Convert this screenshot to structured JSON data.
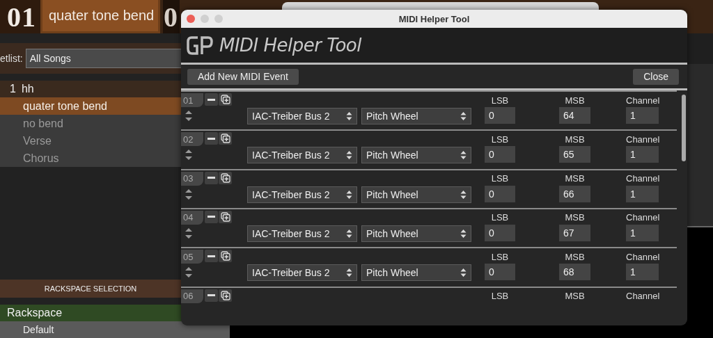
{
  "background_app": {
    "header": {
      "song_number": "01",
      "song_title": "quater tone bend",
      "next_number": "0"
    },
    "setlist": {
      "label": "etlist:",
      "value": "All Songs"
    },
    "songs": [
      {
        "number": "1",
        "name": "hh",
        "parts": [
          {
            "label": "quater tone bend",
            "selected": true
          },
          {
            "label": "no bend",
            "selected": false
          },
          {
            "label": "Verse",
            "selected": false
          },
          {
            "label": "Chorus",
            "selected": false
          }
        ]
      }
    ],
    "rackspace_header": "RACKSPACE SELECTION",
    "rackspaces": [
      {
        "label": "Rackspace",
        "kind": "group"
      },
      {
        "label": "Default",
        "kind": "item"
      }
    ]
  },
  "dialog": {
    "title": "MIDI Helper Tool",
    "banner_title": "MIDI Helper Tool",
    "add_button": "Add New MIDI Event",
    "close_button": "Close",
    "events": [
      {
        "number": "01",
        "device": "IAC-Treiber Bus 2",
        "message": "Pitch Wheel",
        "labels": [
          "LSB",
          "MSB",
          "Channel"
        ],
        "values": [
          "0",
          "64",
          "1"
        ]
      },
      {
        "number": "02",
        "device": "IAC-Treiber Bus 2",
        "message": "Pitch Wheel",
        "labels": [
          "LSB",
          "MSB",
          "Channel"
        ],
        "values": [
          "0",
          "65",
          "1"
        ]
      },
      {
        "number": "03",
        "device": "IAC-Treiber Bus 2",
        "message": "Pitch Wheel",
        "labels": [
          "LSB",
          "MSB",
          "Channel"
        ],
        "values": [
          "0",
          "66",
          "1"
        ]
      },
      {
        "number": "04",
        "device": "IAC-Treiber Bus 2",
        "message": "Pitch Wheel",
        "labels": [
          "LSB",
          "MSB",
          "Channel"
        ],
        "values": [
          "0",
          "67",
          "1"
        ]
      },
      {
        "number": "05",
        "device": "IAC-Treiber Bus 2",
        "message": "Pitch Wheel",
        "labels": [
          "LSB",
          "MSB",
          "Channel"
        ],
        "values": [
          "0",
          "68",
          "1"
        ]
      },
      {
        "number": "06",
        "labels": [
          "LSB",
          "MSB",
          "Channel"
        ]
      }
    ]
  }
}
